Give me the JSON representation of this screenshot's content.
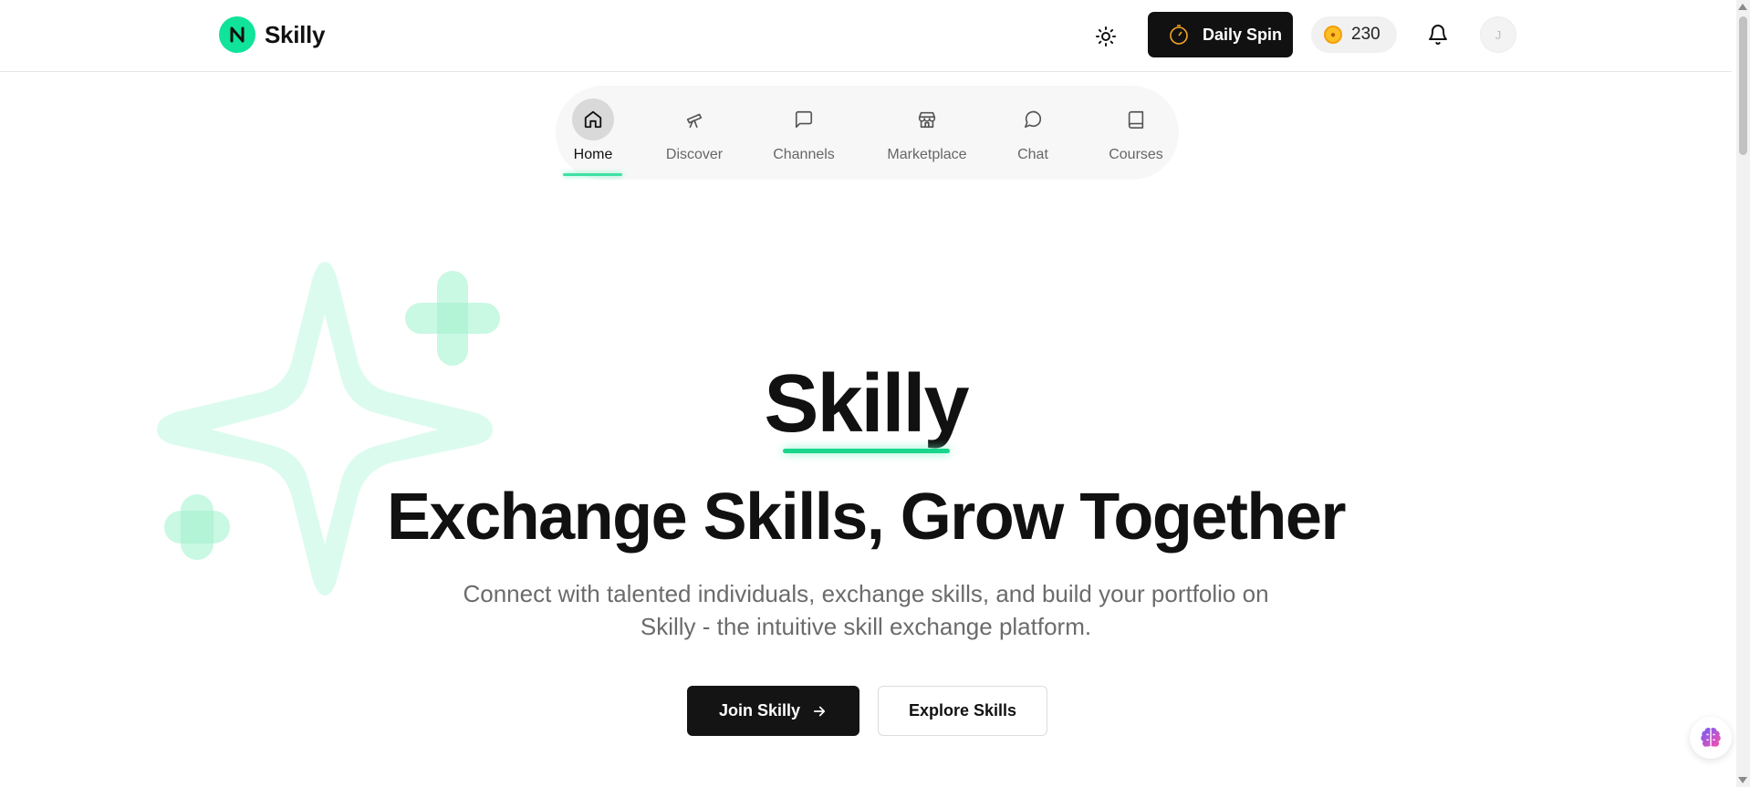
{
  "header": {
    "brand": {
      "name": "Skilly",
      "logo_icon": "n-logo-icon",
      "accent": "#10e39a"
    },
    "theme_toggle_icon": "sun-icon",
    "daily_spin": {
      "label": "Daily Spin",
      "icon": "spin-wheel-icon"
    },
    "coins": {
      "value": "230",
      "icon": "coin-icon"
    },
    "notifications_icon": "bell-icon",
    "avatar_initial": "J"
  },
  "nav": {
    "items": [
      {
        "label": "Home",
        "icon": "home-icon",
        "active": true
      },
      {
        "label": "Discover",
        "icon": "telescope-icon",
        "active": false
      },
      {
        "label": "Channels",
        "icon": "message-square-icon",
        "active": false
      },
      {
        "label": "Marketplace",
        "icon": "store-icon",
        "active": false
      },
      {
        "label": "Chat",
        "icon": "message-circle-icon",
        "active": false
      },
      {
        "label": "Courses",
        "icon": "book-icon",
        "active": false
      }
    ]
  },
  "hero": {
    "title": "Skilly",
    "tagline": "Exchange Skills, Grow Together",
    "description_line1": "Connect with talented individuals, exchange skills, and build your portfolio on",
    "description_line2": "Skilly - the intuitive skill exchange platform.",
    "primary_button": "Join Skilly",
    "secondary_button": "Explore Skills"
  },
  "colors": {
    "accent": "#10e39a",
    "accent_soft": "#d6fbec",
    "dark": "#111111",
    "muted_text": "#6b6b6b"
  },
  "ai_assistant_icon": "brain-icon"
}
